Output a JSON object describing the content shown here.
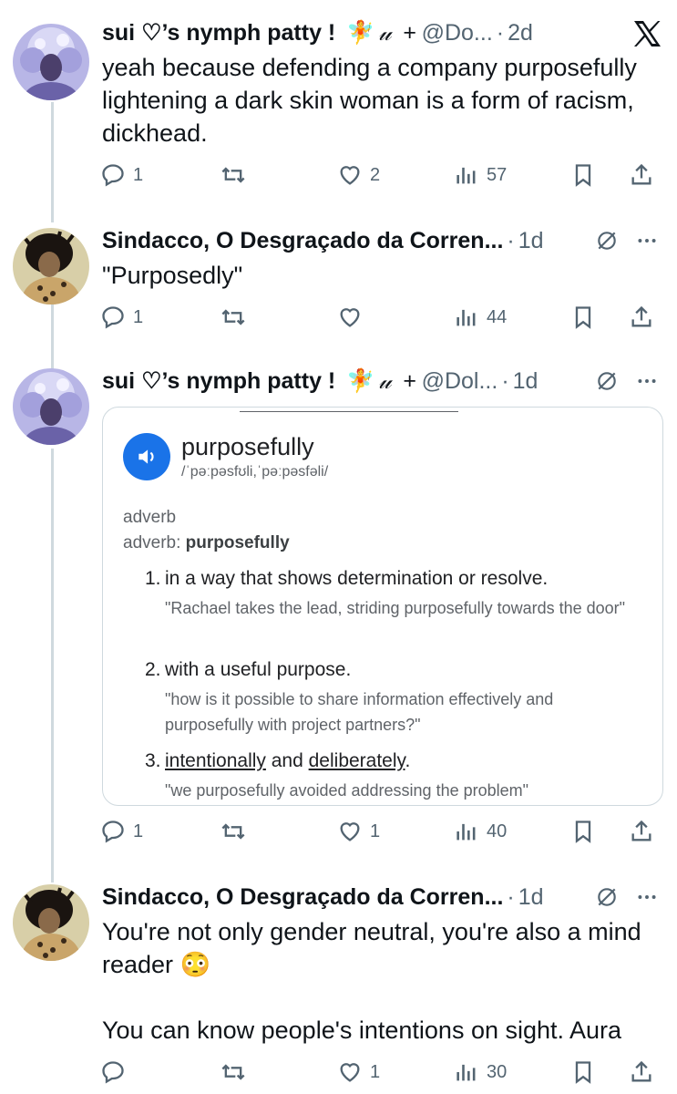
{
  "tweets": [
    {
      "name": "sui ♡’s nymph patty !",
      "badge": "𝓊 +",
      "handle": "@Do...",
      "time": "2d",
      "text": "yeah because defending a company purposefully lightening a dark skin woman is a form of racism, dickhead.",
      "replies": "1",
      "retweets": "",
      "likes": "2",
      "views": "57"
    },
    {
      "name": "Sindacco, O Desgraçado da Corren...",
      "time": "1d",
      "text": "\"Purposedly\"",
      "replies": "1",
      "retweets": "",
      "likes": "",
      "views": "44"
    },
    {
      "name": "sui ♡’s nymph patty !",
      "badge": "𝓊 +",
      "handle": "@Dol...",
      "time": "1d",
      "replies": "1",
      "retweets": "",
      "likes": "1",
      "views": "40"
    },
    {
      "name": "Sindacco, O Desgraçado da Corren...",
      "time": "1d",
      "text": "You're not only gender neutral, you're also a mind reader 😳\n\nYou can know people's intentions on sight. Aura",
      "replies": "",
      "retweets": "",
      "likes": "1",
      "views": "30"
    }
  ],
  "dictionary": {
    "word": "purposefully",
    "pronunciation": "/ˈpəːpəsfʊli,ˈpəːpəsfəli/",
    "pos": "adverb",
    "pos_label": "adverb:",
    "pos_word": "purposefully",
    "definitions": [
      {
        "num": "1.",
        "text": "in a way that shows determination or resolve.",
        "example": "\"Rachael takes the lead, striding purposefully towards the door\""
      },
      {
        "num": "2.",
        "text": "with a useful purpose.",
        "example": "\"how is it possible to share information effectively and purposefully with project partners?\""
      },
      {
        "num": "3.",
        "text_a": "intentionally",
        "text_and": " and ",
        "text_b": "deliberately",
        "text_end": ".",
        "example": "\"we purposefully avoided addressing the problem\""
      }
    ]
  },
  "dot": "·"
}
